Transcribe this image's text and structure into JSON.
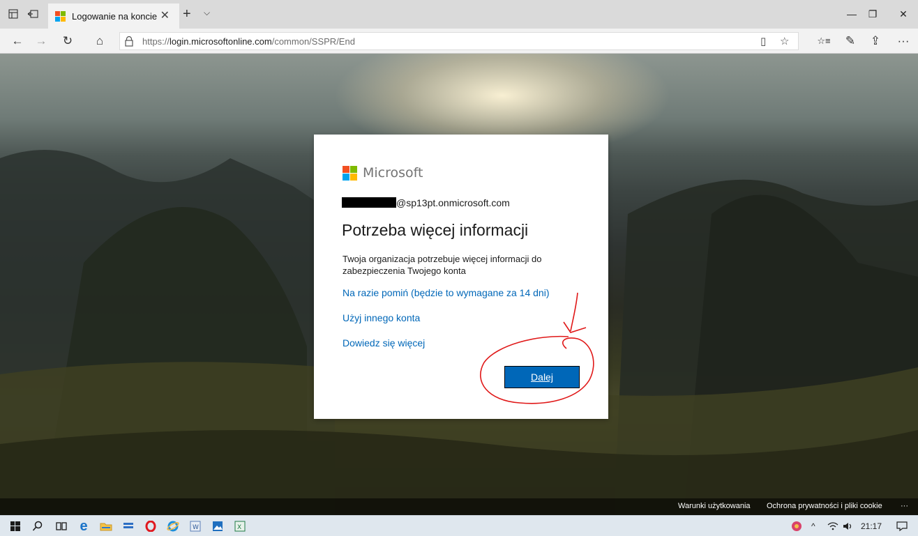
{
  "browser": {
    "tab": {
      "title": "Logowanie na koncie",
      "close_glyph": "✕"
    },
    "new_tab_glyph": "+",
    "tab_menu_glyph": "⌵",
    "window_controls": {
      "minimize": "—",
      "restore": "❐",
      "close": "✕"
    },
    "nav": {
      "back": "←",
      "forward": "→",
      "refresh": "↻",
      "home": "⌂"
    },
    "url": {
      "prefix": "https://",
      "host": "login.microsoftonline.com",
      "path": "/common/SSPR/End"
    },
    "toolbar": {
      "reading_view": "▯",
      "favorite": "☆",
      "favorites_hub": "☆≡",
      "notes": "✎",
      "share": "⇪",
      "more": "···"
    }
  },
  "dialog": {
    "brand": "Microsoft",
    "identity_suffix": "@sp13pt.onmicrosoft.com",
    "heading": "Potrzeba więcej informacji",
    "description": "Twoja organizacja potrzebuje więcej informacji do zabezpieczenia Twojego konta",
    "links": {
      "skip": "Na razie pomiń (będzie to wymagane za 14 dni)",
      "other_account": "Użyj innego konta",
      "learn_more": "Dowiedz się więcej"
    },
    "next_button": "Dalej"
  },
  "footer": {
    "terms": "Warunki użytkowania",
    "privacy": "Ochrona prywatności i pliki cookie",
    "more": "···"
  },
  "taskbar": {
    "clock": "21:17",
    "tray_chevron": "^"
  },
  "colors": {
    "accent": "#0067b8",
    "annotation_red": "#e01818"
  }
}
